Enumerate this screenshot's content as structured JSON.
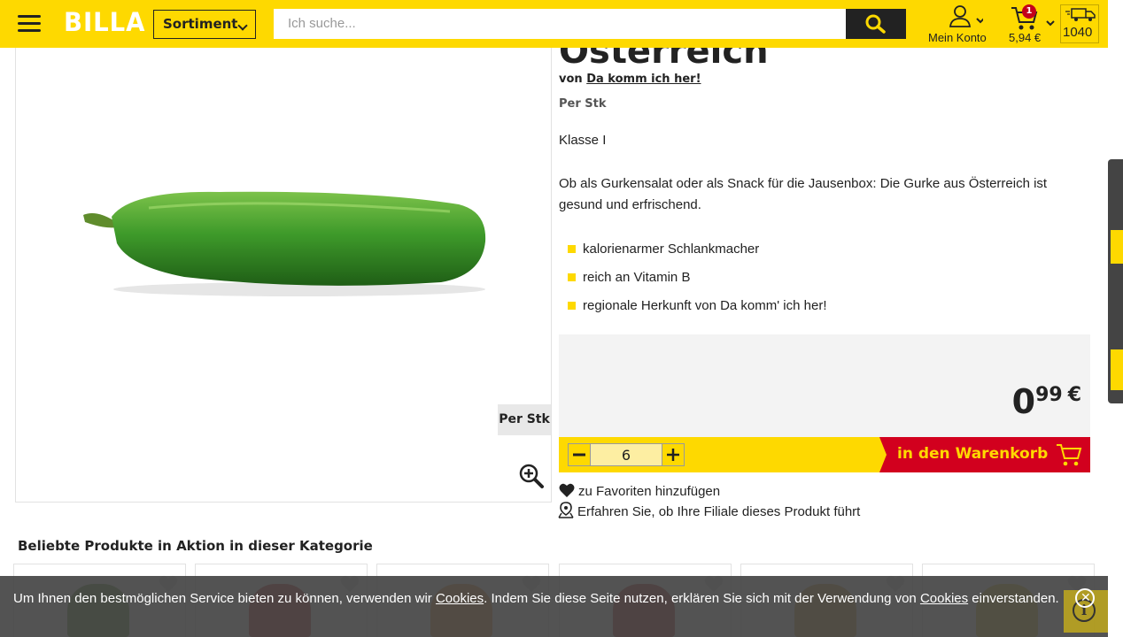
{
  "header": {
    "logo": "BILLA",
    "sortiment_label": "Sortiment",
    "search_placeholder": "Ich suche...",
    "account_label": "Mein Konto",
    "cart_count": "1",
    "cart_total": "5,94 €",
    "delivery_zip": "1040"
  },
  "product": {
    "title": "Österreich",
    "vendor_prefix": "von",
    "vendor_link": "Da komm ich her!",
    "unit": "Per Stk",
    "image_unit_tag": "Per Stk",
    "klasse": "Klasse I",
    "description": "Ob als Gurkensalat oder als Snack für die Jausenbox: Die Gurke aus Österreich ist gesund und erfrischend.",
    "features": [
      "kalorienarmer Schlankmacher",
      "reich an Vitamin B",
      "regionale Herkunft von Da komm' ich her!"
    ],
    "price": {
      "integer": "0",
      "decimal": "99",
      "currency": "€"
    },
    "quantity": "6",
    "add_to_cart_label": "in den Warenkorb",
    "favorite_label": "zu Favoriten hinzufügen",
    "store_check_label": "Erfahren Sie, ob Ihre Filiale dieses Produkt führt"
  },
  "related": {
    "title": "Beliebte Produkte in Aktion in dieser Kategorie",
    "cards": [
      {
        "thumb_color": "#5a8f2e"
      },
      {
        "thumb_color": "#c9231d"
      },
      {
        "thumb_color": "#e98a2b"
      },
      {
        "thumb_color": "#b8251d"
      },
      {
        "thumb_color": "#d79a2a"
      },
      {
        "thumb_color": "#d8c21c"
      }
    ]
  },
  "cookie": {
    "text_1": "Um Ihnen den bestmöglichen Service bieten zu können, verwenden wir ",
    "link_1": "Cookies",
    "text_2": ". Indem Sie diese Seite nutzen, erklären Sie sich mit der Verwendung von ",
    "link_2": "Cookies",
    "text_3": " einverstanden.",
    "close_symbol": "✕",
    "info_symbol": "i"
  },
  "colors": {
    "brand_yellow": "#fed900",
    "brand_red": "#d2001e"
  }
}
